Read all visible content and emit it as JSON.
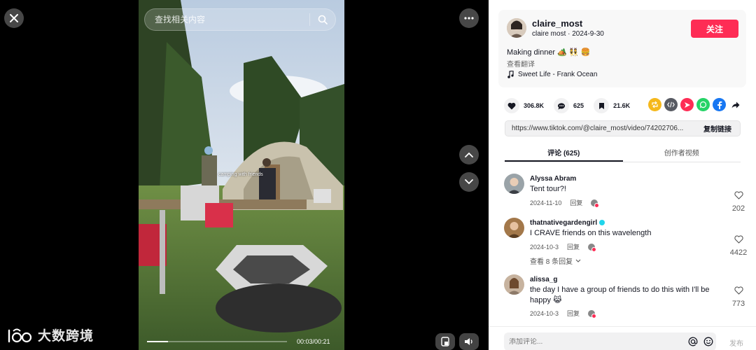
{
  "search": {
    "placeholder": "查找相关内容"
  },
  "video": {
    "caption": "camping with friends",
    "time": "00:03/00:21",
    "progress": 0.15
  },
  "watermark": {
    "text": "大数跨境"
  },
  "author": {
    "username": "claire_most",
    "subline": "claire most · 2024-9-30",
    "follow_label": "关注",
    "description": "Making dinner 🏕️ 👯 🍔",
    "translate_label": "查看翻译",
    "music": "Sweet Life - Frank Ocean"
  },
  "stats": {
    "likes": "306.8K",
    "comments": "625",
    "saves": "21.6K"
  },
  "share": {
    "url": "https://www.tiktok.com/@claire_most/video/74202706...",
    "copy_label": "复制链接",
    "icons": [
      "repost-icon",
      "embed-icon",
      "send-icon",
      "whatsapp-icon",
      "facebook-icon",
      "share-arrow-icon"
    ]
  },
  "tabs": [
    {
      "label": "评论 (625)",
      "active": true
    },
    {
      "label": "创作者视频",
      "active": false
    }
  ],
  "comments": [
    {
      "user": "Alyssa Abram",
      "text": "Tent tour?!",
      "date": "2024-11-10",
      "reply_label": "回复",
      "likes": "202"
    },
    {
      "user": "thatnativegardengirl",
      "verified": true,
      "text": "I CRAVE friends on this wavelength",
      "date": "2024-10-3",
      "reply_label": "回复",
      "likes": "4422",
      "view_replies": "查看 8 条回复"
    },
    {
      "user": "alissa_g",
      "text": "the day I have a group of friends to do this with I'll be happy 😹",
      "date": "2024-10-3",
      "reply_label": "回复",
      "likes": "773"
    }
  ],
  "comment_input": {
    "placeholder": "添加评论...",
    "post_label": "发布"
  },
  "colors": {
    "accent": "#fe2c55",
    "panel_bg": "#ffffff",
    "card_bg": "#f8f8f8"
  }
}
